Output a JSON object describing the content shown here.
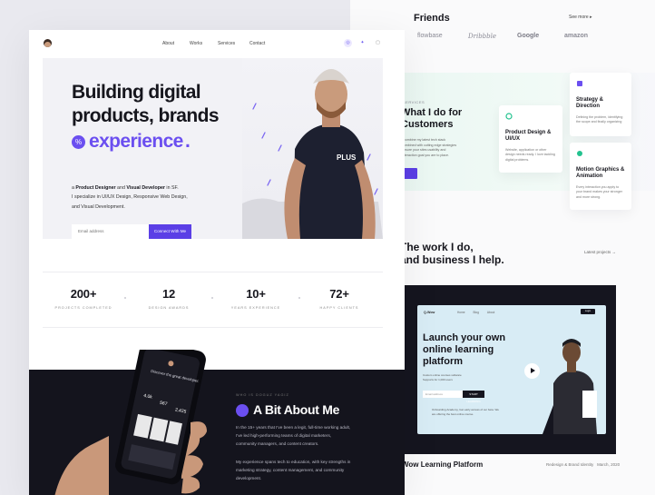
{
  "friends": {
    "title": "Friends",
    "see_more": "See more",
    "logos": [
      "flowbase",
      "Dribbble",
      "Google",
      "amazon"
    ]
  },
  "services": {
    "small": "SERVICES",
    "title": "What I do for Customers",
    "description": "I combine my latest tech stack combined with cutting edge strategies ensure your sites usability and interaction goal you are to place.",
    "cards": [
      {
        "title": "Strategy & Direction",
        "desc": "Defining the problem, identifying the scope and finally organizing"
      },
      {
        "title": "Product Design & UI/UX",
        "desc": "Website, application or other design needs ready. I love tackling digital problems."
      },
      {
        "title": "Motion Graphics & Animation",
        "desc": "Every interaction you apply to your brand makes your stronger and more strong."
      }
    ]
  },
  "work": {
    "title_line1": "The work I do,",
    "title_line2": "and business I help.",
    "latest": "Latest projects  →"
  },
  "project": {
    "logo": "Q-Wow",
    "nav": [
      "Home",
      "Blog",
      "About"
    ],
    "login": "Login",
    "headline": "Launch your own online learning platform",
    "bullets": "Custom online courses software\nSupports for 1,000 users",
    "email_placeholder": "Email address",
    "start": "START LEARNING",
    "footnote": "Onboarding Academy, Get early access of our beta. We are offering the best online course.",
    "title": "Wow Learning Platform",
    "category": "Redesign & Brand Identity",
    "date": "March, 2020"
  },
  "nav": {
    "links": [
      "About",
      "Works",
      "Services",
      "Contact"
    ],
    "social": [
      "dribbble-icon",
      "twitter-icon",
      "instagram-icon"
    ]
  },
  "hero": {
    "line1": "Building digital",
    "line2": "products, brands",
    "line3": "experience",
    "desc_pre": "a ",
    "desc_role1": "Product Designer",
    "desc_and": " and ",
    "desc_role2": "Visual Developer",
    "desc_post": " in SF.",
    "desc_line2": "I specialize in UI/UX Design, Responsive Web Design,",
    "desc_line3": "and Visual Development.",
    "email_placeholder": "Email address",
    "cta": "Connect With Me",
    "shirt_text": "PLUS"
  },
  "stats": [
    {
      "value": "200+",
      "label": "PROJECTS COMPLETED"
    },
    {
      "value": "12",
      "label": "DESIGN AWARDS"
    },
    {
      "value": "10+",
      "label": "YEARS EXPERIENCE"
    },
    {
      "value": "72+",
      "label": "HAPPY CLIENTS"
    }
  ],
  "about": {
    "small": "WHO IS DOGUZ YAGIZ",
    "title": "A Bit About Me",
    "p1": "In the 15+ years that I've been a legit, full-time working adult, I've led high-performing teams of digital marketers, community managers, and content creators.",
    "p2": "My experience spans tech to education, with key strengths in marketing strategy, content management, and community development."
  },
  "phone": {
    "greeting": "Discover the great developer.",
    "s1": "4.0k",
    "s2": "567",
    "s3": "2,425"
  },
  "colors": {
    "accent": "#6b4ff0",
    "dark": "#14141d",
    "hero_bg": "#f2f2f6",
    "mint": "#eaf7f2"
  }
}
